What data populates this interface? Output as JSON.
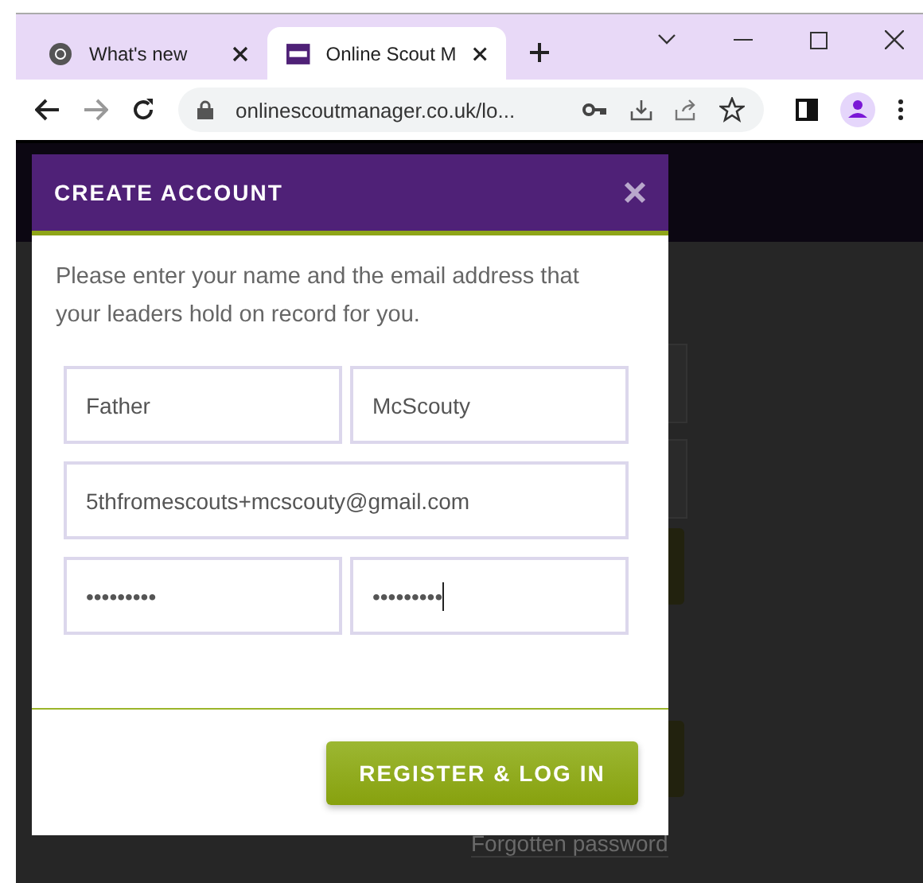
{
  "browser": {
    "tabs": [
      {
        "title": "What's new",
        "kind": "chrome",
        "selected": false
      },
      {
        "title": "Online Scout M",
        "kind": "site",
        "selected": true
      }
    ],
    "url": "onlinescoutmanager.co.uk/lo..."
  },
  "dialog": {
    "title": "CREATE ACCOUNT",
    "message": "Please enter your name and the email address that your leaders hold on record for you.",
    "fields": [
      {
        "value": "Father",
        "wide": false,
        "focused": false
      },
      {
        "value": "McScouty",
        "wide": false,
        "focused": false
      },
      {
        "value": "5thfromescouts+mcscouty@gmail.com",
        "wide": true,
        "focused": false
      },
      {
        "value": "•••••••••",
        "wide": false,
        "focused": false
      },
      {
        "value": "•••••••••",
        "wide": false,
        "focused": true
      }
    ],
    "button": "REGISTER & LOG IN"
  },
  "background_page": {
    "link": "Forgotten password"
  }
}
